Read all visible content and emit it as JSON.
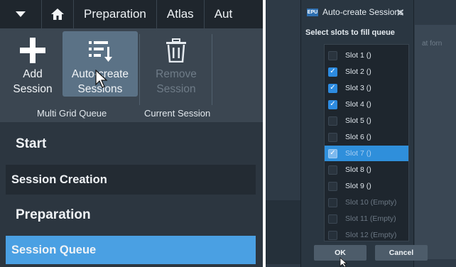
{
  "left": {
    "tabs": [
      "Preparation",
      "Atlas",
      "Aut"
    ],
    "ribbon": {
      "add_label": "Add\nSession",
      "auto_label": "Auto-create\nSessions",
      "remove_label": "Remove\nSession",
      "group1": "Multi Grid Queue",
      "group2": "Current Session"
    },
    "nav": {
      "start": "Start",
      "session_creation": "Session Creation",
      "preparation": "Preparation",
      "session_queue": "Session Queue"
    }
  },
  "dialog": {
    "app_badge": "EPU",
    "title": "Auto-create Sessions",
    "close": "✕",
    "prompt": "Select slots to fill queue",
    "slots": [
      {
        "label": "Slot 1 ()",
        "checked": false,
        "enabled": true,
        "selected": false
      },
      {
        "label": "Slot 2 ()",
        "checked": true,
        "enabled": true,
        "selected": false
      },
      {
        "label": "Slot 3 ()",
        "checked": true,
        "enabled": true,
        "selected": false
      },
      {
        "label": "Slot 4 ()",
        "checked": true,
        "enabled": true,
        "selected": false
      },
      {
        "label": "Slot 5 ()",
        "checked": false,
        "enabled": true,
        "selected": false
      },
      {
        "label": "Slot 6 ()",
        "checked": false,
        "enabled": true,
        "selected": false
      },
      {
        "label": "Slot 7 ()",
        "checked": true,
        "enabled": true,
        "selected": true
      },
      {
        "label": "Slot 8 ()",
        "checked": false,
        "enabled": true,
        "selected": false
      },
      {
        "label": "Slot 9 ()",
        "checked": false,
        "enabled": true,
        "selected": false
      },
      {
        "label": "Slot 10 (Empty)",
        "checked": false,
        "enabled": false,
        "selected": false
      },
      {
        "label": "Slot 11 (Empty)",
        "checked": false,
        "enabled": false,
        "selected": false
      },
      {
        "label": "Slot 12 (Empty)",
        "checked": false,
        "enabled": false,
        "selected": false
      }
    ],
    "ok_label": "OK",
    "cancel_label": "Cancel"
  },
  "background_text": "at forn"
}
